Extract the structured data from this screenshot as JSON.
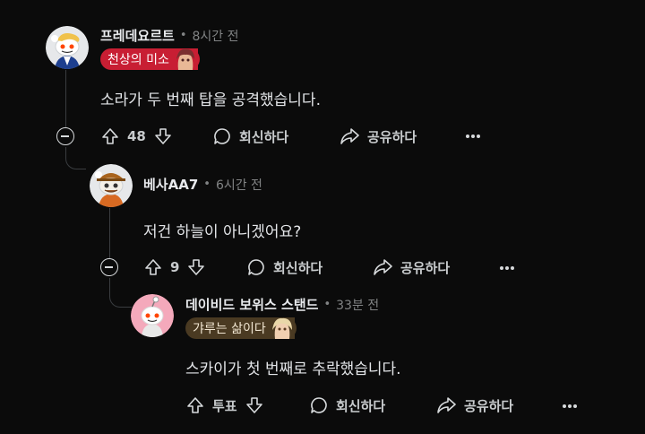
{
  "comments": [
    {
      "author": "프레데요르트",
      "time": "8시간 전",
      "flair": "천상의 미소",
      "flair_color": "#c81e33",
      "body": "소라가 두 번째 탑을 공격했습니다.",
      "votes": "48",
      "reply_label": "회신하다",
      "share_label": "공유하다",
      "more_icon": "more-icon"
    },
    {
      "author": "베사AA7",
      "time": "6시간 전",
      "body": "저건 하늘이 아니겠어요?",
      "votes": "9",
      "reply_label": "회신하다",
      "share_label": "공유하다"
    },
    {
      "author": "데이비드 보위스 스탠드",
      "time": "33분 전",
      "flair": "갸루는 삶이다",
      "flair_color": "#4a3a22",
      "body": "스카이가 첫 번째로 추락했습니다.",
      "votes": "투표",
      "reply_label": "회신하다",
      "share_label": "공유하다"
    }
  ],
  "separator": "•"
}
